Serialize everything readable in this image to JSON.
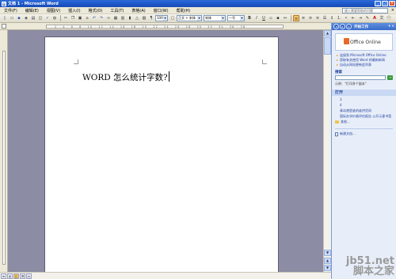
{
  "window": {
    "title": "文档 1 - Microsoft Word",
    "app_icon": "W"
  },
  "menu": {
    "items": [
      "文件(F)",
      "编辑(E)",
      "视图(V)",
      "插入(I)",
      "格式(O)",
      "工具(T)",
      "表格(A)",
      "窗口(W)",
      "帮助(H)"
    ],
    "help_placeholder": "键入需要帮助的问题"
  },
  "toolbar": {
    "zoom": "100%",
    "style": "正文 + 宋体",
    "font": "宋体",
    "size": "一号",
    "bold": "B",
    "italic": "I",
    "underline": "U",
    "font_color_letter": "A"
  },
  "document": {
    "text": "WORD 怎么统计字数?"
  },
  "taskpane": {
    "title": "开始工作",
    "office_online": "Office Online",
    "links": [
      "连接到 Microsoft Office Online",
      "获取有关使用 Word 的最新新闻",
      "自动从网站更新此列表"
    ],
    "search_label": "搜索",
    "example": "示例：\"打印多个副本\"",
    "open_section": "打开",
    "files": [
      "3",
      "4",
      "青岛港是谁的谁供货间",
      "国际办学价格评估报告 公开示意书签"
    ],
    "more": "其他...",
    "new_doc": "新建文档..."
  },
  "watermark": {
    "site": "jb51.net",
    "cn": "脚本之家"
  },
  "colors": {
    "title_blue": "#1c55c7",
    "doc_bg": "#8c8ca4",
    "taskpane_bg": "#e8eef9"
  }
}
